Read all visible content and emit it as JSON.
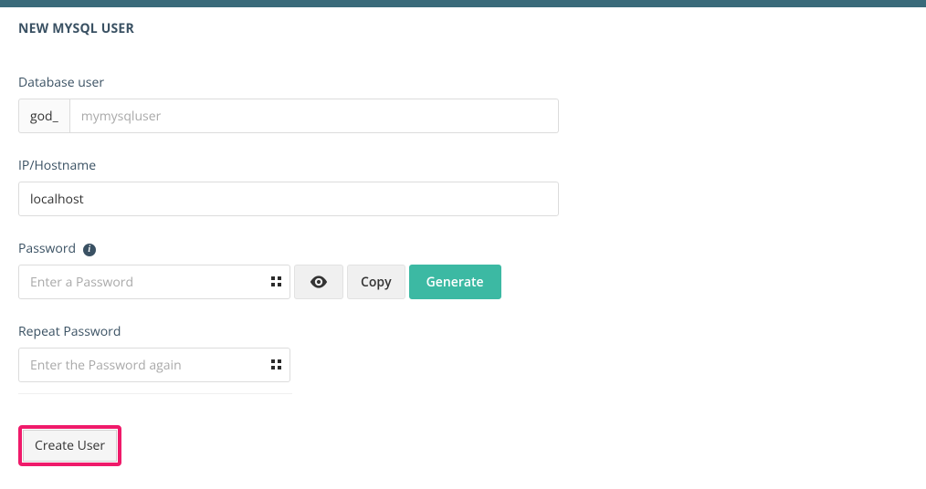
{
  "page": {
    "title": "NEW MYSQL USER"
  },
  "form": {
    "dbuser_label": "Database user",
    "dbuser_prefix": "god_",
    "dbuser_placeholder": "mymysqluser",
    "dbuser_value": "",
    "ip_label": "IP/Hostname",
    "ip_value": "localhost",
    "password_label": "Password",
    "password_placeholder": "Enter a Password",
    "password_value": "",
    "reveal_label": "Show password",
    "copy_label": "Copy",
    "generate_label": "Generate",
    "repeat_label": "Repeat Password",
    "repeat_placeholder": "Enter the Password again",
    "repeat_value": "",
    "submit_label": "Create User"
  }
}
